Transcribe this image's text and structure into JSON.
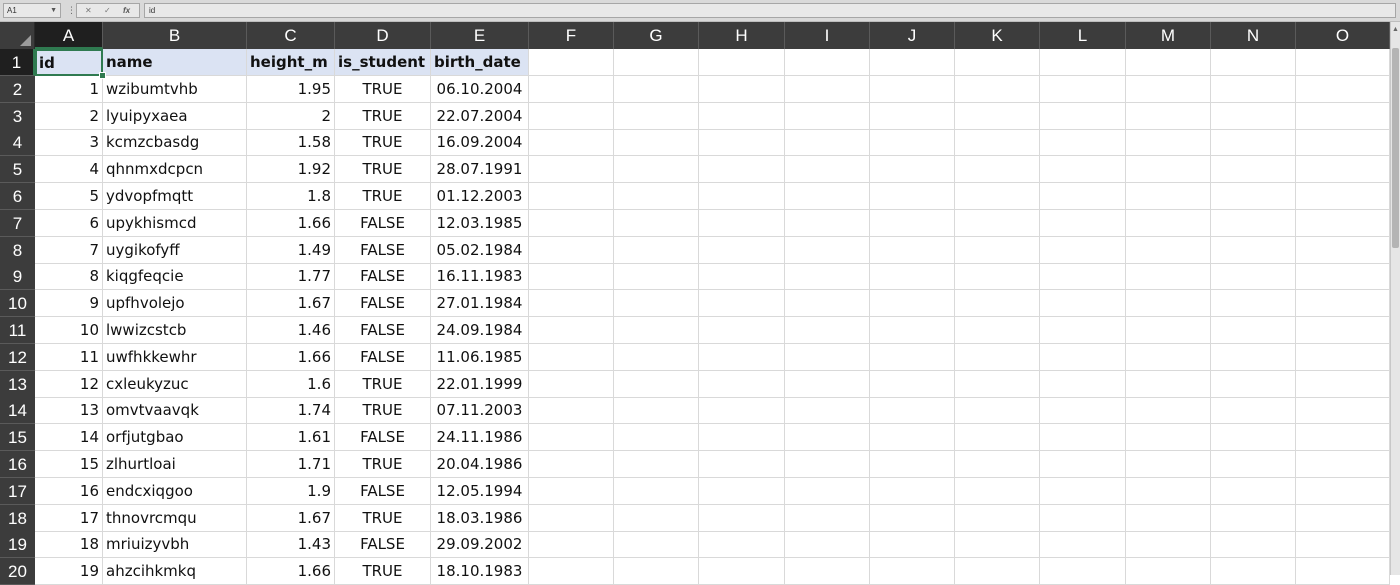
{
  "formula_bar": {
    "name_box": "A1",
    "fx_label": "fx",
    "cancel_glyph": "✕",
    "enter_glyph": "✓",
    "content": "id"
  },
  "colors": {
    "header_bg": "#3c3c3c",
    "selected_header_bg": "#1f1f1f",
    "accent_green": "#2f7a50",
    "table_header_fill": "#dbe3f3",
    "gridline": "#d9d9d9"
  },
  "columns": [
    "A",
    "B",
    "C",
    "D",
    "E",
    "F",
    "G",
    "H",
    "I",
    "J",
    "K",
    "L",
    "M",
    "N",
    "O"
  ],
  "active_cell": "A1",
  "table": {
    "headers": [
      "id",
      "name",
      "height_m",
      "is_student",
      "birth_date"
    ],
    "rows": [
      [
        "1",
        "wzibumtvhb",
        "1.95",
        "TRUE",
        "06.10.2004"
      ],
      [
        "2",
        "lyuipyxaea",
        "2",
        "TRUE",
        "22.07.2004"
      ],
      [
        "3",
        "kcmzcbasdg",
        "1.58",
        "TRUE",
        "16.09.2004"
      ],
      [
        "4",
        "qhnmxdcpcn",
        "1.92",
        "TRUE",
        "28.07.1991"
      ],
      [
        "5",
        "ydvopfmqtt",
        "1.8",
        "TRUE",
        "01.12.2003"
      ],
      [
        "6",
        "upykhismcd",
        "1.66",
        "FALSE",
        "12.03.1985"
      ],
      [
        "7",
        "uygikofyff",
        "1.49",
        "FALSE",
        "05.02.1984"
      ],
      [
        "8",
        "kiqgfeqcie",
        "1.77",
        "FALSE",
        "16.11.1983"
      ],
      [
        "9",
        "upfhvolejo",
        "1.67",
        "FALSE",
        "27.01.1984"
      ],
      [
        "10",
        "lwwizcstcb",
        "1.46",
        "FALSE",
        "24.09.1984"
      ],
      [
        "11",
        "uwfhkkewhr",
        "1.66",
        "FALSE",
        "11.06.1985"
      ],
      [
        "12",
        "cxleukyzuc",
        "1.6",
        "TRUE",
        "22.01.1999"
      ],
      [
        "13",
        "omvtvaavqk",
        "1.74",
        "TRUE",
        "07.11.2003"
      ],
      [
        "14",
        "orfjutgbao",
        "1.61",
        "FALSE",
        "24.11.1986"
      ],
      [
        "15",
        "zlhurtloai",
        "1.71",
        "TRUE",
        "20.04.1986"
      ],
      [
        "16",
        "endcxiqgoo",
        "1.9",
        "FALSE",
        "12.05.1994"
      ],
      [
        "17",
        "thnovrcmqu",
        "1.67",
        "TRUE",
        "18.03.1986"
      ],
      [
        "18",
        "mriuizyvbh",
        "1.43",
        "FALSE",
        "29.09.2002"
      ],
      [
        "19",
        "ahzcihkmkq",
        "1.66",
        "TRUE",
        "18.10.1983"
      ]
    ]
  }
}
